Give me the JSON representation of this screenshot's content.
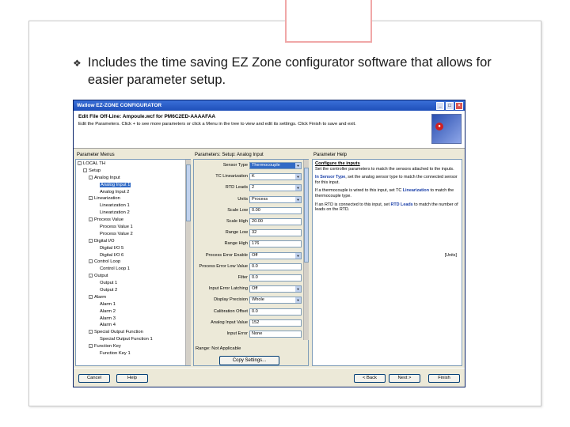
{
  "slide": {
    "bullet": "Includes the time saving EZ Zone configurator software that allows for easier parameter setup."
  },
  "window": {
    "title": "Watlow EZ-ZONE CONFIGURATOR",
    "header_title": "Edit File Off-Line: Ampoule.wcf for PM6C2ED-AAAAFAA",
    "header_text": "Edit the Parameters. Click + to see more parameters or click a Menu in the tree to view and edit its settings. Click Finish to save and exit."
  },
  "panes": {
    "menus_label": "Parameter Menus",
    "setup_label": "Parameters: Setup: Analog Input",
    "help_label": "Parameter Help"
  },
  "tree": [
    {
      "indent": 0,
      "box": "-",
      "label": "LOCAL TH"
    },
    {
      "indent": 1,
      "box": "-",
      "label": "Setup"
    },
    {
      "indent": 2,
      "box": "-",
      "label": "Analog Input"
    },
    {
      "indent": 3,
      "box": "",
      "label": "Analog Input 1",
      "selected": true
    },
    {
      "indent": 3,
      "box": "",
      "label": "Analog Input 2"
    },
    {
      "indent": 2,
      "box": "-",
      "label": "Linearization"
    },
    {
      "indent": 3,
      "box": "",
      "label": "Linearization 1"
    },
    {
      "indent": 3,
      "box": "",
      "label": "Linearization 2"
    },
    {
      "indent": 2,
      "box": "-",
      "label": "Process Value"
    },
    {
      "indent": 3,
      "box": "",
      "label": "Process Value 1"
    },
    {
      "indent": 3,
      "box": "",
      "label": "Process Value 2"
    },
    {
      "indent": 2,
      "box": "-",
      "label": "Digital I/O"
    },
    {
      "indent": 3,
      "box": "",
      "label": "Digital I/O 5"
    },
    {
      "indent": 3,
      "box": "",
      "label": "Digital I/O 6"
    },
    {
      "indent": 2,
      "box": "-",
      "label": "Control Loop"
    },
    {
      "indent": 3,
      "box": "",
      "label": "Control Loop 1"
    },
    {
      "indent": 2,
      "box": "-",
      "label": "Output"
    },
    {
      "indent": 3,
      "box": "",
      "label": "Output 1"
    },
    {
      "indent": 3,
      "box": "",
      "label": "Output 2"
    },
    {
      "indent": 2,
      "box": "-",
      "label": "Alarm"
    },
    {
      "indent": 3,
      "box": "",
      "label": "Alarm 1"
    },
    {
      "indent": 3,
      "box": "",
      "label": "Alarm 2"
    },
    {
      "indent": 3,
      "box": "",
      "label": "Alarm 3"
    },
    {
      "indent": 3,
      "box": "",
      "label": "Alarm 4"
    },
    {
      "indent": 2,
      "box": "-",
      "label": "Special Output Function"
    },
    {
      "indent": 3,
      "box": "",
      "label": "Special Output Function 1"
    },
    {
      "indent": 2,
      "box": "-",
      "label": "Function Key"
    },
    {
      "indent": 3,
      "box": "",
      "label": "Function Key 1"
    }
  ],
  "params": [
    {
      "label": "Sensor Type",
      "value": "Thermocouple",
      "dropdown": true,
      "selected": true
    },
    {
      "label": "TC Linearization",
      "value": "K",
      "dropdown": true
    },
    {
      "label": "RTD Leads",
      "value": "2",
      "dropdown": true
    },
    {
      "label": "Units",
      "value": "Process",
      "dropdown": true
    },
    {
      "label": "Scale Low",
      "value": "0.00",
      "dropdown": false
    },
    {
      "label": "Scale High",
      "value": "20.00",
      "dropdown": false
    },
    {
      "label": "Range Low",
      "value": "32",
      "dropdown": false
    },
    {
      "label": "Range High",
      "value": "176",
      "dropdown": false
    },
    {
      "label": "Process Error Enable",
      "value": "Off",
      "dropdown": true
    },
    {
      "label": "Process Error Low Value",
      "value": "0.0",
      "dropdown": false
    },
    {
      "label": "Filter",
      "value": "0.0",
      "dropdown": false
    },
    {
      "label": "Input Error Latching",
      "value": "Off",
      "dropdown": true
    },
    {
      "label": "Display Precision",
      "value": "Whole",
      "dropdown": true
    },
    {
      "label": "Calibration Offset",
      "value": "0.0",
      "dropdown": false
    },
    {
      "label": "Analog Input Value",
      "value": "152",
      "dropdown": false
    },
    {
      "label": "Input Error",
      "value": "None",
      "dropdown": false
    }
  ],
  "range_text": "Range: Not Applicable",
  "copy_button": "Copy Settings...",
  "help": {
    "title": "Configure the inputs",
    "p1": "Set the controller parameters to match the sensors attached to the inputs.",
    "p2_bold": "In Sensor Type",
    "p2": ", set the analog sensor type to match the connected sensor for this input.",
    "p3a": "If a thermocouple is wired to this input, set TC ",
    "p3_bold": "Linearization",
    "p3b": " to match the thermocouple type.",
    "p4a": "If an RTD is connected to this input, set ",
    "p4_bold": "RTD Leads",
    "p4b": " to match the number of leads on the RTD.",
    "units": "[Units]"
  },
  "footer": {
    "cancel": "Cancel",
    "help": "Help",
    "back": "< Back",
    "next": "Next >",
    "finish": "Finish"
  }
}
